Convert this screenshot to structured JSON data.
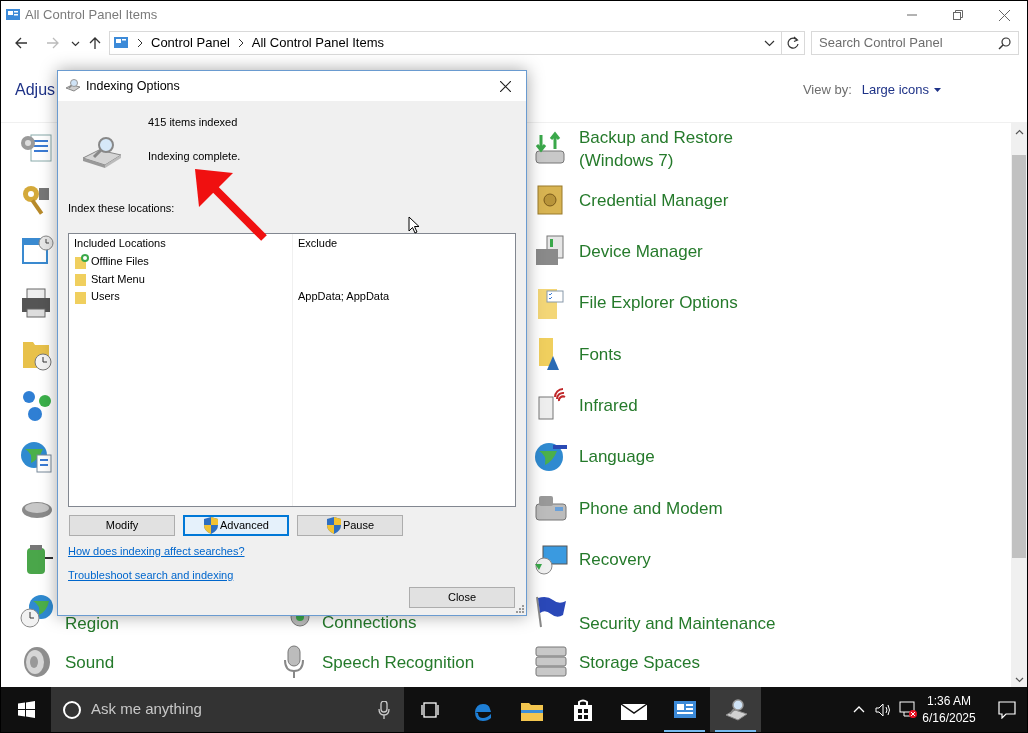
{
  "window": {
    "title": "All Control Panel Items"
  },
  "nav": {
    "breadcrumb": [
      "Control Panel",
      "All Control Panel Items"
    ],
    "search_placeholder": "Search Control Panel"
  },
  "header": {
    "heading": "Adjus",
    "view_by_label": "View by:",
    "view_by_value": "Large icons"
  },
  "columns": [
    {
      "items": [
        {
          "kind": "icon-only"
        },
        {
          "kind": "icon-only"
        },
        {
          "kind": "icon-only"
        },
        {
          "kind": "icon-only"
        },
        {
          "kind": "icon-only"
        },
        {
          "kind": "icon-only"
        },
        {
          "kind": "icon-only"
        },
        {
          "kind": "icon-only"
        },
        {
          "kind": "icon-only"
        },
        {
          "kind": "labeled",
          "label": "Region"
        },
        {
          "kind": "labeled",
          "label": "Sound"
        }
      ]
    },
    {
      "items": [
        {
          "kind": "labeled",
          "label": "Connections"
        },
        {
          "kind": "labeled",
          "label": "Speech Recognition"
        }
      ]
    },
    {
      "items": [
        {
          "kind": "labeled",
          "label": "Backup and Restore\n(Windows 7)"
        },
        {
          "kind": "labeled",
          "label": "Credential Manager"
        },
        {
          "kind": "labeled",
          "label": "Device Manager"
        },
        {
          "kind": "labeled",
          "label": "File Explorer Options"
        },
        {
          "kind": "labeled",
          "label": "Fonts"
        },
        {
          "kind": "labeled",
          "label": "Infrared"
        },
        {
          "kind": "labeled",
          "label": "Language"
        },
        {
          "kind": "labeled",
          "label": "Phone and Modem"
        },
        {
          "kind": "labeled",
          "label": "Recovery"
        },
        {
          "kind": "labeled",
          "label": "Security and Maintenance"
        },
        {
          "kind": "labeled",
          "label": "Storage Spaces"
        }
      ]
    }
  ],
  "dialog": {
    "title": "Indexing Options",
    "item_count": "415 items indexed",
    "status": "Indexing complete.",
    "locations_label": "Index these locations:",
    "table": {
      "columns": [
        "Included Locations",
        "Exclude"
      ],
      "rows": [
        {
          "location": "Offline Files",
          "kind": "offline"
        },
        {
          "location": "Start Menu",
          "kind": "folder"
        },
        {
          "location": "Users",
          "kind": "folder",
          "exclude": "AppData; AppData"
        }
      ]
    },
    "buttons": [
      {
        "label": "Modify",
        "shield": false,
        "focused": false
      },
      {
        "label": "Advanced",
        "shield": true,
        "focused": true
      },
      {
        "label": "Pause",
        "shield": true,
        "focused": false
      }
    ],
    "links": [
      "How does indexing affect searches?",
      "Troubleshoot search and indexing"
    ],
    "close_button": "Close"
  },
  "taskbar": {
    "search_placeholder": "Ask me anything",
    "apps": [
      {
        "kind": "edge",
        "running": false,
        "selected": false
      },
      {
        "kind": "explorer",
        "running": false,
        "selected": false
      },
      {
        "kind": "store",
        "running": false,
        "selected": false
      },
      {
        "kind": "mail",
        "running": false,
        "selected": false
      },
      {
        "kind": "control-panel",
        "running": true,
        "selected": false
      },
      {
        "kind": "indexing",
        "running": true,
        "selected": true
      }
    ],
    "clock": {
      "time": "1:36 AM",
      "date": "6/16/2025"
    }
  }
}
